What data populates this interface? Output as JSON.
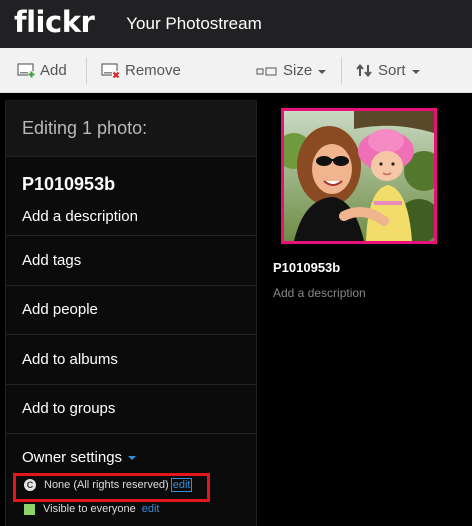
{
  "header": {
    "logo": "flickr",
    "title": "Your Photostream"
  },
  "toolbar": {
    "add_label": "Add",
    "remove_label": "Remove",
    "size_label": "Size",
    "sort_label": "Sort"
  },
  "panel": {
    "header": "Editing 1 photo:",
    "photo_name": "P1010953b",
    "add_description": "Add a description",
    "rows": [
      "Add tags",
      "Add people",
      "Add to albums",
      "Add to groups"
    ],
    "owner_settings": "Owner settings",
    "license_text": "None (All rights reserved)",
    "license_icon_glyph": "C",
    "license_edit": "edit",
    "visibility_text": "Visible to everyone",
    "visibility_edit": "edit"
  },
  "photo": {
    "title": "P1010953b",
    "description_placeholder": "Add a description"
  },
  "colors": {
    "highlight_box": "#e4161c",
    "selected_border": "#e8107b",
    "link": "#3d8bd6",
    "visibility_indicator": "#8fd468"
  }
}
